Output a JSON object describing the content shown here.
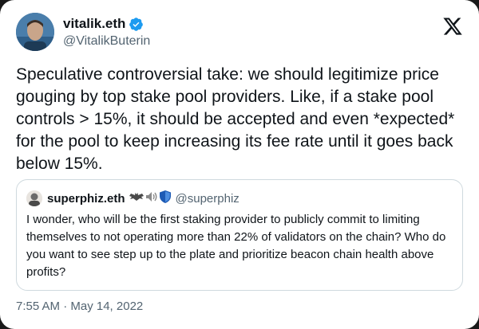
{
  "author": {
    "display_name": "vitalik.eth",
    "handle": "@VitalikButerin"
  },
  "tweet": {
    "text": "Speculative controversial take: we should legitimize price gouging by top stake pool providers. Like, if a stake pool controls > 15%, it should be accepted and even *expected* for the pool to keep increasing its fee rate until it goes back below 15%."
  },
  "quote": {
    "display_name": "superphiz.eth",
    "handle": "@superphiz",
    "text": "I wonder, who will be the first staking provider to publicly commit to limiting themselves to not operating more than 22% of validators on the chain? Who do you want to see step up to the plate and prioritize beacon chain health above profits?"
  },
  "timestamp": "7:55 AM · May 14, 2022",
  "icons": {
    "verified": "verified-badge-icon",
    "logo": "x-logo-icon",
    "name_emoji": [
      "bat-icon",
      "speaker-icon",
      "shield-icon"
    ]
  },
  "colors": {
    "verified": "#1d9bf0",
    "secondary_text": "#536471",
    "border": "#cfd9de"
  }
}
